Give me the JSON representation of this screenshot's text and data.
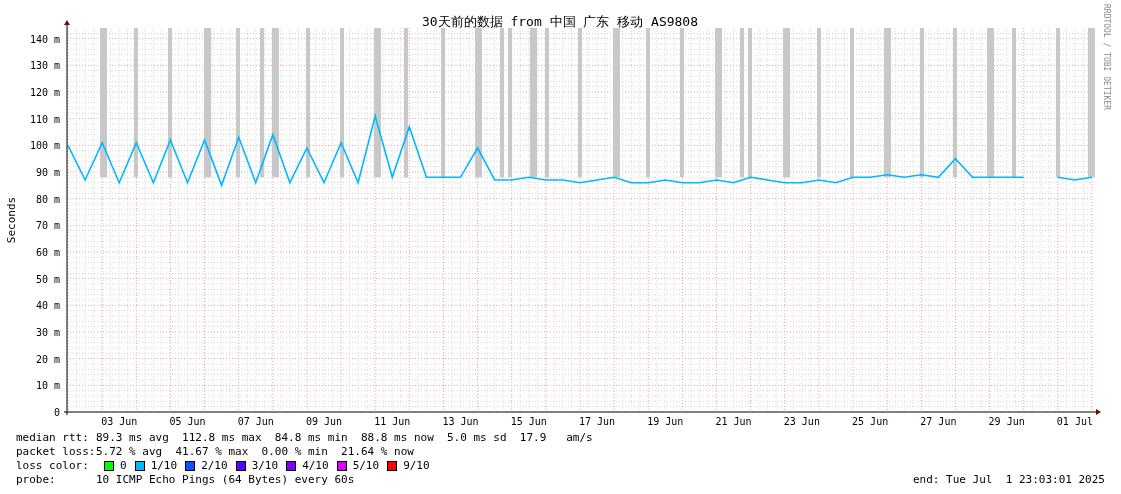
{
  "chart": {
    "title": "30天前的数据 from 中国 广东 移动 AS9808",
    "side_note": "RRDTOOL / TOBI OETIKER",
    "chart_data": {
      "type": "line",
      "grid": true,
      "ylabel": "Seconds",
      "ylim": [
        0,
        144
      ],
      "yticks": [
        {
          "value": 0,
          "label": "0"
        },
        {
          "value": 10,
          "label": "10 m"
        },
        {
          "value": 20,
          "label": "20 m"
        },
        {
          "value": 30,
          "label": "30 m"
        },
        {
          "value": 40,
          "label": "40 m"
        },
        {
          "value": 50,
          "label": "50 m"
        },
        {
          "value": 60,
          "label": "60 m"
        },
        {
          "value": 70,
          "label": "70 m"
        },
        {
          "value": 80,
          "label": "80 m"
        },
        {
          "value": 90,
          "label": "90 m"
        },
        {
          "value": 100,
          "label": "100 m"
        },
        {
          "value": 110,
          "label": "110 m"
        },
        {
          "value": 120,
          "label": "120 m"
        },
        {
          "value": 130,
          "label": "130 m"
        },
        {
          "value": 140,
          "label": "140 m"
        }
      ],
      "categories": [
        null,
        null,
        null,
        "03 Jun",
        null,
        null,
        null,
        "05 Jun",
        null,
        null,
        null,
        "07 Jun",
        null,
        null,
        null,
        "09 Jun",
        null,
        null,
        null,
        "11 Jun",
        null,
        null,
        null,
        "13 Jun",
        null,
        null,
        null,
        "15 Jun",
        null,
        null,
        null,
        "17 Jun",
        null,
        null,
        null,
        "19 Jun",
        null,
        null,
        null,
        "21 Jun",
        null,
        null,
        null,
        "23 Jun",
        null,
        null,
        null,
        "25 Jun",
        null,
        null,
        null,
        "27 Jun",
        null,
        null,
        null,
        "29 Jun",
        null,
        null,
        null,
        "01 Jul",
        null
      ],
      "series": [
        {
          "color": "#00b8ff",
          "values": [
            100,
            87,
            101,
            86,
            101,
            86,
            102,
            86,
            102,
            85,
            103,
            86,
            104,
            86,
            99,
            86,
            101,
            86,
            111,
            88,
            107,
            88,
            88,
            88,
            99,
            87,
            87,
            88,
            87,
            87,
            86,
            87,
            88,
            86,
            86,
            87,
            86,
            86,
            87,
            86,
            88,
            87,
            86,
            86,
            87,
            86,
            88,
            88,
            89,
            88,
            89,
            88,
            95,
            88,
            88,
            88,
            88,
            null,
            88,
            87,
            88
          ]
        }
      ]
    }
  },
  "legend": {
    "stats": [
      {
        "label": "median rtt:",
        "text": "89.3 ms avg  112.8 ms max  84.8 ms min  88.8 ms now  5.0 ms sd  17.9   am/s"
      },
      {
        "label": "packet loss:",
        "text": "5.72 % avg  41.67 % max  0.00 % min  21.64 % now"
      }
    ],
    "loss_label": "loss color:",
    "loss_colors": [
      {
        "label": "0",
        "color": "#00ff00"
      },
      {
        "label": "1/10",
        "color": "#00b8ff"
      },
      {
        "label": "2/10",
        "color": "#0059ff"
      },
      {
        "label": "3/10",
        "color": "#5e00ff"
      },
      {
        "label": "4/10",
        "color": "#7e00ff"
      },
      {
        "label": "5/10",
        "color": "#dd00ff"
      },
      {
        "label": "9/10",
        "color": "#ff0000"
      }
    ],
    "probe_label": "probe:",
    "probe": "10 ICMP Echo Pings (64 Bytes) every 60s",
    "end": "end: Tue Jul  1 23:03:01 2025"
  }
}
